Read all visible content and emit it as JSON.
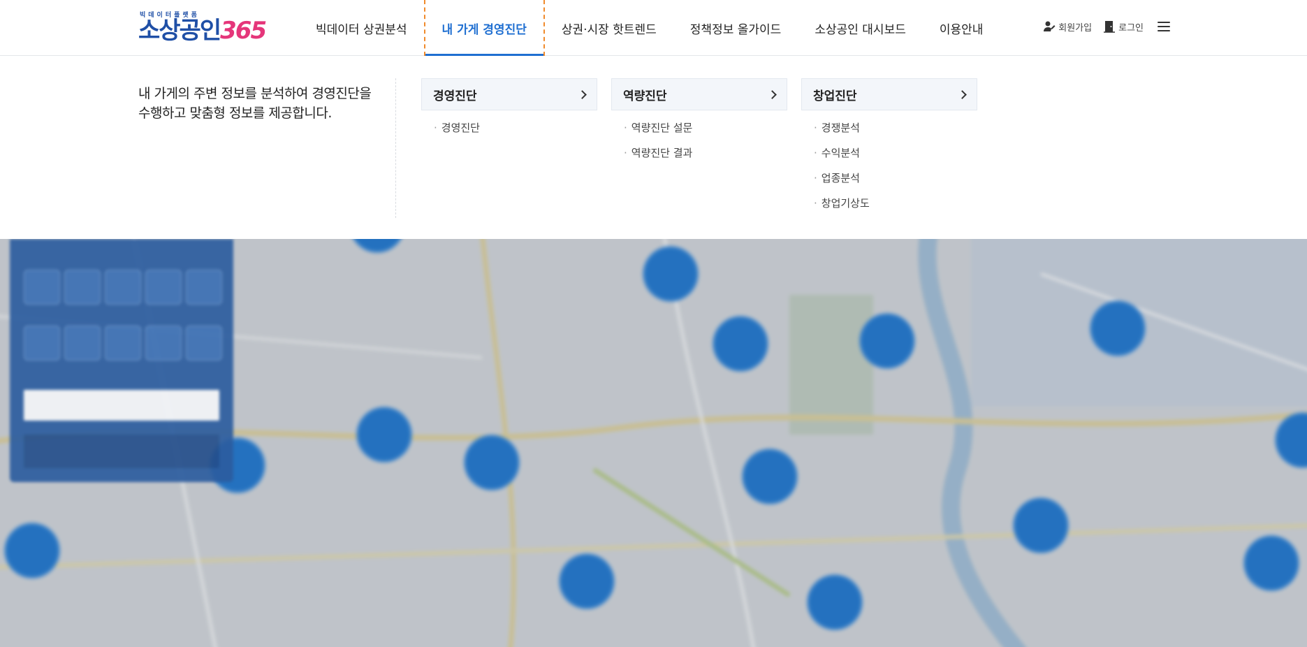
{
  "header": {
    "logo_sub": "빅데이터플랫폼",
    "logo_text": "소상공인",
    "logo_num": "365",
    "nav": [
      {
        "label": "빅데이터 상권분석",
        "active": false
      },
      {
        "label": "내 가게 경영진단",
        "active": true
      },
      {
        "label": "상권·시장 핫트렌드",
        "active": false
      },
      {
        "label": "정책정보 올가이드",
        "active": false
      },
      {
        "label": "소상공인 대시보드",
        "active": false
      },
      {
        "label": "이용안내",
        "active": false
      }
    ],
    "util": {
      "signup_label": "회원가입",
      "login_label": "로그인",
      "signup_icon": "user-plus-icon",
      "login_icon": "door-icon",
      "menu_icon": "hamburger-menu-icon"
    }
  },
  "dropdown": {
    "description": "내 가게의 주변 정보를 분석하여 경영진단을 수행하고 맞춤형 정보를 제공합니다.",
    "columns": [
      {
        "title": "경영진단",
        "items": [
          "경영진단"
        ]
      },
      {
        "title": "역량진단",
        "items": [
          "역량진단 설문",
          "역량진단 결과"
        ]
      },
      {
        "title": "창업진단",
        "items": [
          "경쟁분석",
          "수익분석",
          "업종분석",
          "창업기상도"
        ]
      }
    ]
  },
  "colors": {
    "brand_blue": "#1f4fa6",
    "brand_pink": "#e5367a",
    "active_blue": "#1f6fd1",
    "active_outline": "#f08a2b",
    "cluster_blue": "#1f7bd6"
  },
  "map": {
    "cluster_count": 16
  }
}
